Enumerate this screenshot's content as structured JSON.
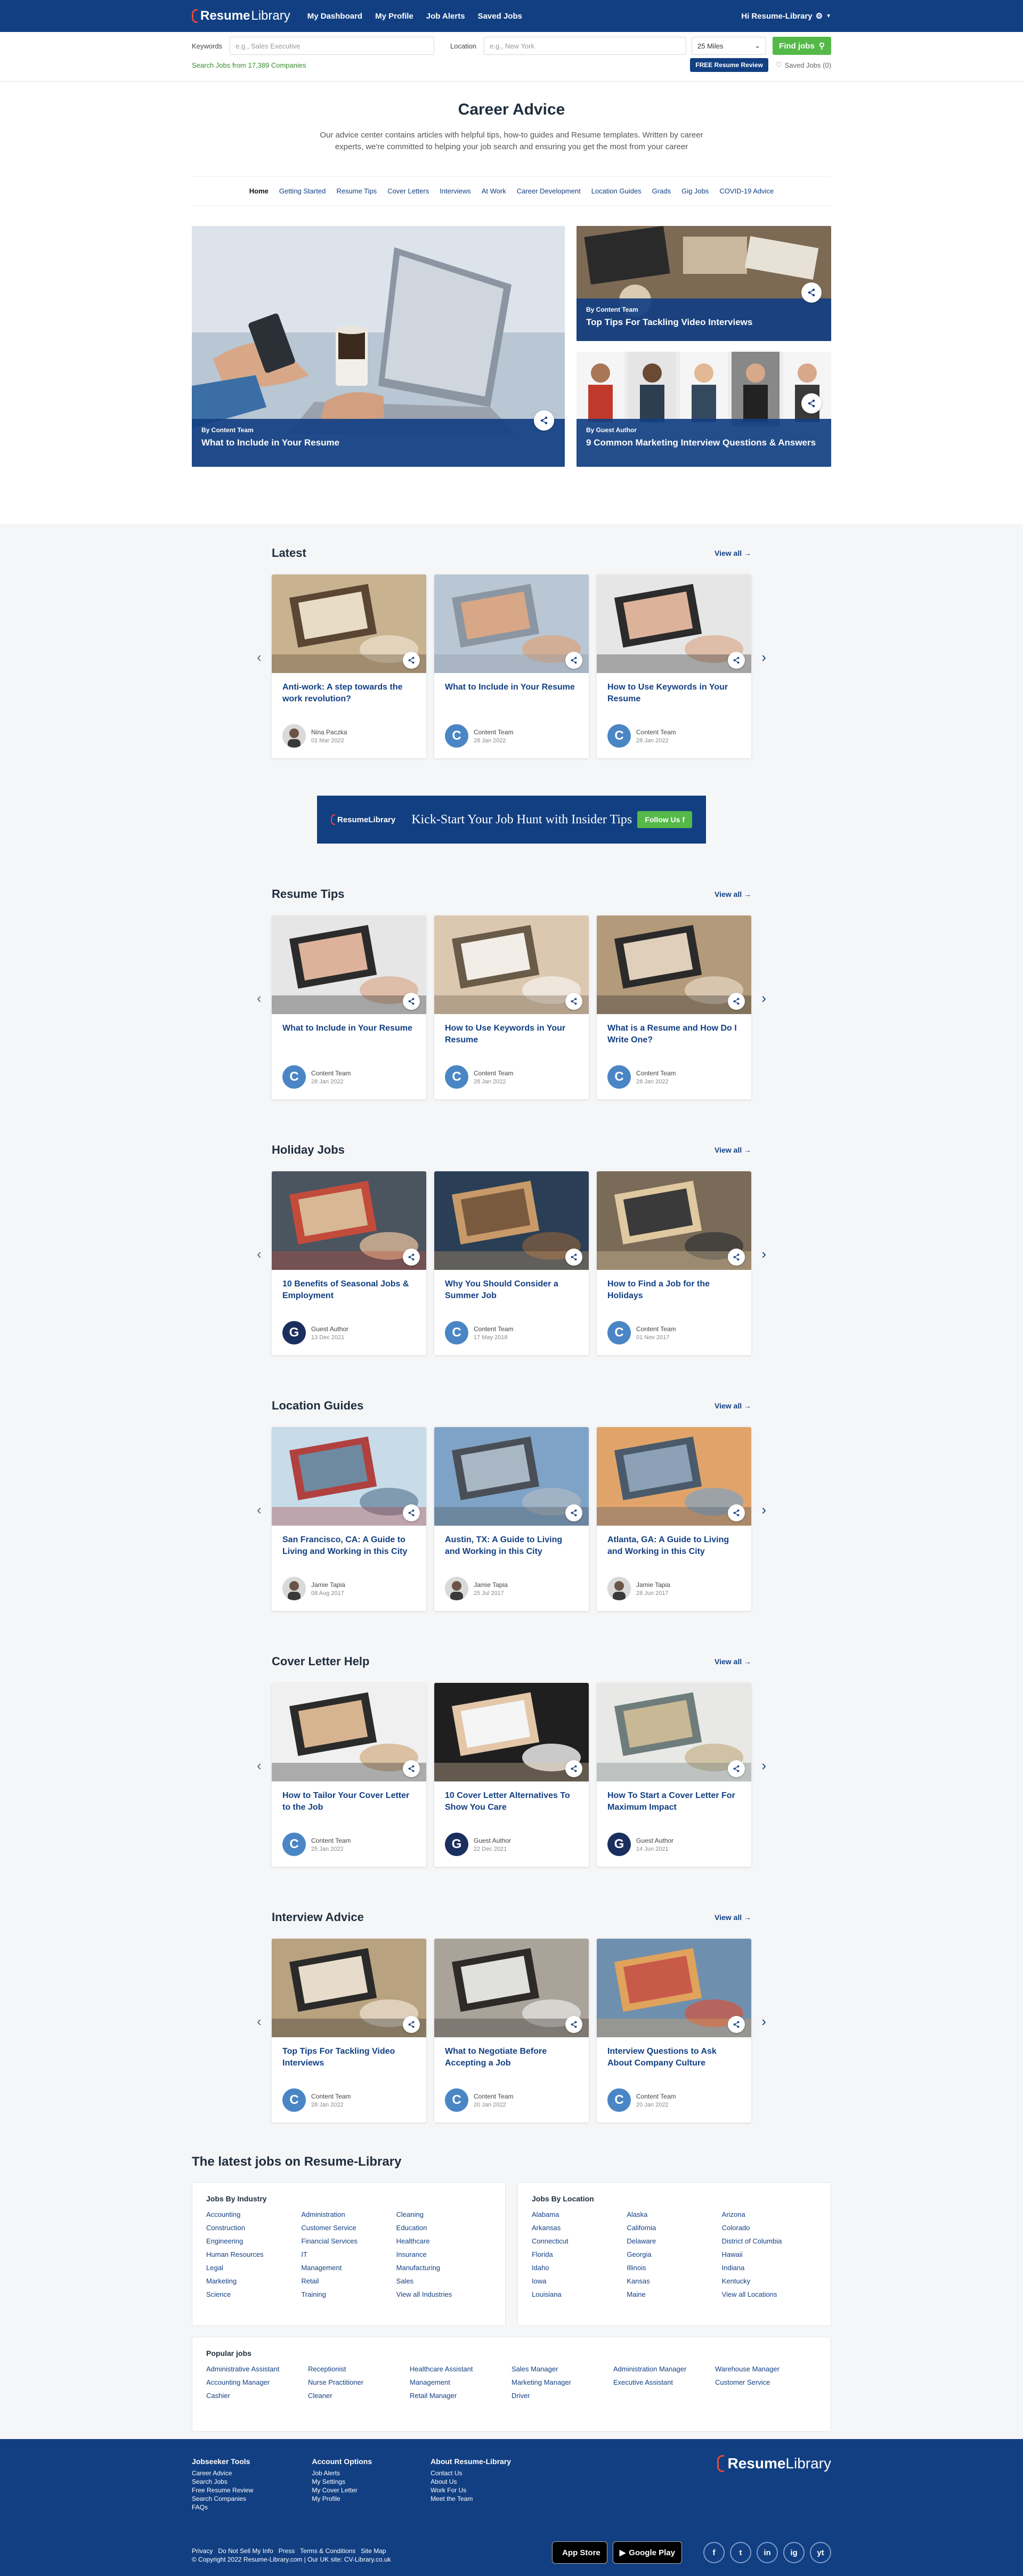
{
  "header": {
    "logo_bold": "Resume",
    "logo_light": "Library",
    "nav": [
      "My Dashboard",
      "My Profile",
      "Job Alerts",
      "Saved Jobs"
    ],
    "user": "Hi Resume-Library"
  },
  "search": {
    "keywords_label": "Keywords",
    "keywords_placeholder": "e.g., Sales Executive",
    "location_label": "Location",
    "location_placeholder": "e.g., New York",
    "miles": "25 Miles",
    "find": "Find jobs",
    "count_text": "Search Jobs from 17,389 Companies",
    "free_review": "FREE Resume Review",
    "saved_jobs": "Saved Jobs (0)"
  },
  "hero": {
    "title": "Career Advice",
    "intro": "Our advice center contains articles with helpful tips, how-to guides and Resume templates. Written by career experts, we're committed to helping your job search and ensuring you get the most from your career"
  },
  "categories": [
    "Home",
    "Getting Started",
    "Resume Tips",
    "Cover Letters",
    "Interviews",
    "At Work",
    "Career Development",
    "Location Guides",
    "Grads",
    "Gig Jobs",
    "COVID-19 Advice"
  ],
  "featured": {
    "main": {
      "by": "By Content Team",
      "title": "What to Include in Your Resume"
    },
    "side": [
      {
        "by": "By Content Team",
        "title": "Top Tips For Tackling Video Interviews"
      },
      {
        "by": "By Guest Author",
        "title": "9 Common Marketing Interview Questions & Answers"
      }
    ]
  },
  "view_all": "View all",
  "banner": {
    "logo": "ResumeLibrary",
    "text": "Kick-Start Your Job Hunt with Insider Tips",
    "follow": "Follow Us"
  },
  "sections": [
    {
      "title": "Latest",
      "cards": [
        {
          "title": "Anti-work: A step towards the work revolution?",
          "author": "Nina Paczka",
          "date": "01 Mar 2022",
          "avatar": "photo"
        },
        {
          "title": "What to Include in Your Resume",
          "author": "Content Team",
          "date": "28 Jan 2022",
          "avatar": "C"
        },
        {
          "title": "How to Use Keywords in Your Resume",
          "author": "Content Team",
          "date": "28 Jan 2022",
          "avatar": "C"
        }
      ]
    },
    {
      "title": "Resume Tips",
      "cards": [
        {
          "title": "What to Include in Your Resume",
          "author": "Content Team",
          "date": "28 Jan 2022",
          "avatar": "C"
        },
        {
          "title": "How to Use Keywords in Your Resume",
          "author": "Content Team",
          "date": "28 Jan 2022",
          "avatar": "C"
        },
        {
          "title": "What is a Resume and How Do I Write One?",
          "author": "Content Team",
          "date": "28 Jan 2022",
          "avatar": "C"
        }
      ]
    },
    {
      "title": "Holiday Jobs",
      "cards": [
        {
          "title": "10 Benefits of Seasonal Jobs & Employment",
          "author": "Guest Author",
          "date": "13 Dec 2021",
          "avatar": "G"
        },
        {
          "title": "Why You Should Consider a Summer Job",
          "author": "Content Team",
          "date": "17 May 2018",
          "avatar": "C"
        },
        {
          "title": "How to Find a Job for the Holidays",
          "author": "Content Team",
          "date": "01 Nov 2017",
          "avatar": "C"
        }
      ]
    },
    {
      "title": "Location Guides",
      "cards": [
        {
          "title": "San Francisco, CA: A Guide to Living and Working in this City",
          "author": "Jamie Tapia",
          "date": "08 Aug 2017",
          "avatar": "photo"
        },
        {
          "title": "Austin, TX: A Guide to Living and Working in this City",
          "author": "Jamie Tapia",
          "date": "25 Jul 2017",
          "avatar": "photo"
        },
        {
          "title": "Atlanta, GA: A Guide to Living and Working in this City",
          "author": "Jamie Tapia",
          "date": "28 Jun 2017",
          "avatar": "photo"
        }
      ]
    },
    {
      "title": "Cover Letter Help",
      "cards": [
        {
          "title": "How to Tailor Your Cover Letter to the Job",
          "author": "Content Team",
          "date": "25 Jan 2022",
          "avatar": "C"
        },
        {
          "title": "10 Cover Letter Alternatives To Show You Care",
          "author": "Guest Author",
          "date": "22 Dec 2021",
          "avatar": "G"
        },
        {
          "title": "How To Start a Cover Letter For Maximum Impact",
          "author": "Guest Author",
          "date": "14 Jun 2021",
          "avatar": "G"
        }
      ]
    },
    {
      "title": "Interview Advice",
      "cards": [
        {
          "title": "Top Tips For Tackling Video Interviews",
          "author": "Content Team",
          "date": "28 Jan 2022",
          "avatar": "C"
        },
        {
          "title": "What to Negotiate Before Accepting a Job",
          "author": "Content Team",
          "date": "20 Jan 2022",
          "avatar": "C"
        },
        {
          "title": "Interview Questions to Ask About Company Culture",
          "author": "Content Team",
          "date": "20 Jan 2022",
          "avatar": "C"
        }
      ]
    }
  ],
  "jobs": {
    "title": "The latest jobs on Resume-Library",
    "industry": {
      "title": "Jobs By Industry",
      "cols": [
        [
          "Accounting",
          "Construction",
          "Engineering",
          "Human Resources",
          "Legal",
          "Marketing",
          "Science"
        ],
        [
          "Administration",
          "Customer Service",
          "Financial Services",
          "IT",
          "Management",
          "Retail",
          "Training"
        ],
        [
          "Cleaning",
          "Education",
          "Healthcare",
          "Insurance",
          "Manufacturing",
          "Sales",
          "View all Industries"
        ]
      ]
    },
    "location": {
      "title": "Jobs By Location",
      "cols": [
        [
          "Alabama",
          "Arkansas",
          "Connecticut",
          "Florida",
          "Idaho",
          "Iowa",
          "Louisiana"
        ],
        [
          "Alaska",
          "California",
          "Delaware",
          "Georgia",
          "Illinois",
          "Kansas",
          "Maine"
        ],
        [
          "Arizona",
          "Colorado",
          "District of Columbia",
          "Hawaii",
          "Indiana",
          "Kentucky",
          "View all Locations"
        ]
      ]
    },
    "popular": {
      "title": "Popular jobs",
      "cols": [
        [
          "Administrative Assistant",
          "Accounting Manager",
          "Cashier"
        ],
        [
          "Receptionist",
          "Nurse Practitioner",
          "Cleaner"
        ],
        [
          "Healthcare Assistant",
          "Management",
          "Retail Manager"
        ],
        [
          "Sales Manager",
          "Marketing Manager",
          "Driver"
        ],
        [
          "Administration Manager",
          "Executive Assistant"
        ],
        [
          "Warehouse Manager",
          "Customer Service"
        ]
      ]
    }
  },
  "footer": {
    "cols": [
      {
        "title": "Jobseeker Tools",
        "links": [
          "Career Advice",
          "Search Jobs",
          "Free Resume Review",
          "Search Companies",
          "FAQs"
        ]
      },
      {
        "title": "Account Options",
        "links": [
          "Job Alerts",
          "My Settings",
          "My Cover Letter",
          "My Profile"
        ]
      },
      {
        "title": "About Resume-Library",
        "links": [
          "Contact Us",
          "About Us",
          "Work For Us",
          "Meet the Team"
        ]
      }
    ],
    "links_row1": "Privacy   Do Not Sell My Info   Press   Terms & Conditions   Site Map",
    "copyright": "© Copyright 2022 Resume-Library.com | Our UK site: CV-Library.co.uk",
    "app_store": "App Store",
    "google_play": "Google Play",
    "social": [
      "f",
      "t",
      "in",
      "ig",
      "yt"
    ]
  }
}
